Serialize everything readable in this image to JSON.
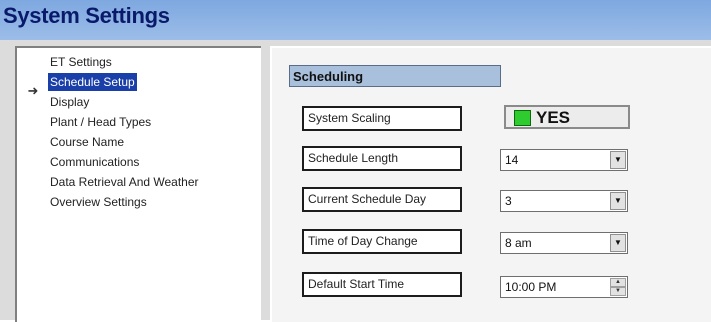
{
  "window": {
    "title": "System Settings"
  },
  "nav": {
    "arrow_icon": "right-arrow-icon",
    "items": [
      {
        "label": "ET Settings"
      },
      {
        "label": "Schedule Setup",
        "selected": true
      },
      {
        "label": "Display"
      },
      {
        "label": "Plant / Head Types"
      },
      {
        "label": "Course Name"
      },
      {
        "label": "Communications"
      },
      {
        "label": "Data Retrieval And Weather"
      },
      {
        "label": "Overview Settings"
      }
    ]
  },
  "scheduling": {
    "header": "Scheduling",
    "system_scaling": {
      "label": "System Scaling",
      "value": "YES",
      "indicator_color": "#2fcc2f"
    },
    "schedule_length": {
      "label": "Schedule Length",
      "value": "14"
    },
    "current_schedule_day": {
      "label": "Current Schedule Day",
      "value": "3"
    },
    "time_of_day_change": {
      "label": "Time of Day Change",
      "value": "8 am"
    },
    "default_start_time": {
      "label": "Default Start Time",
      "value": "10:00 PM"
    }
  },
  "colors": {
    "title_bar": "#8fb4e6",
    "title_text": "#0a1a6a",
    "selection": "#1a3fa8",
    "section_header": "#a9c0dd"
  }
}
